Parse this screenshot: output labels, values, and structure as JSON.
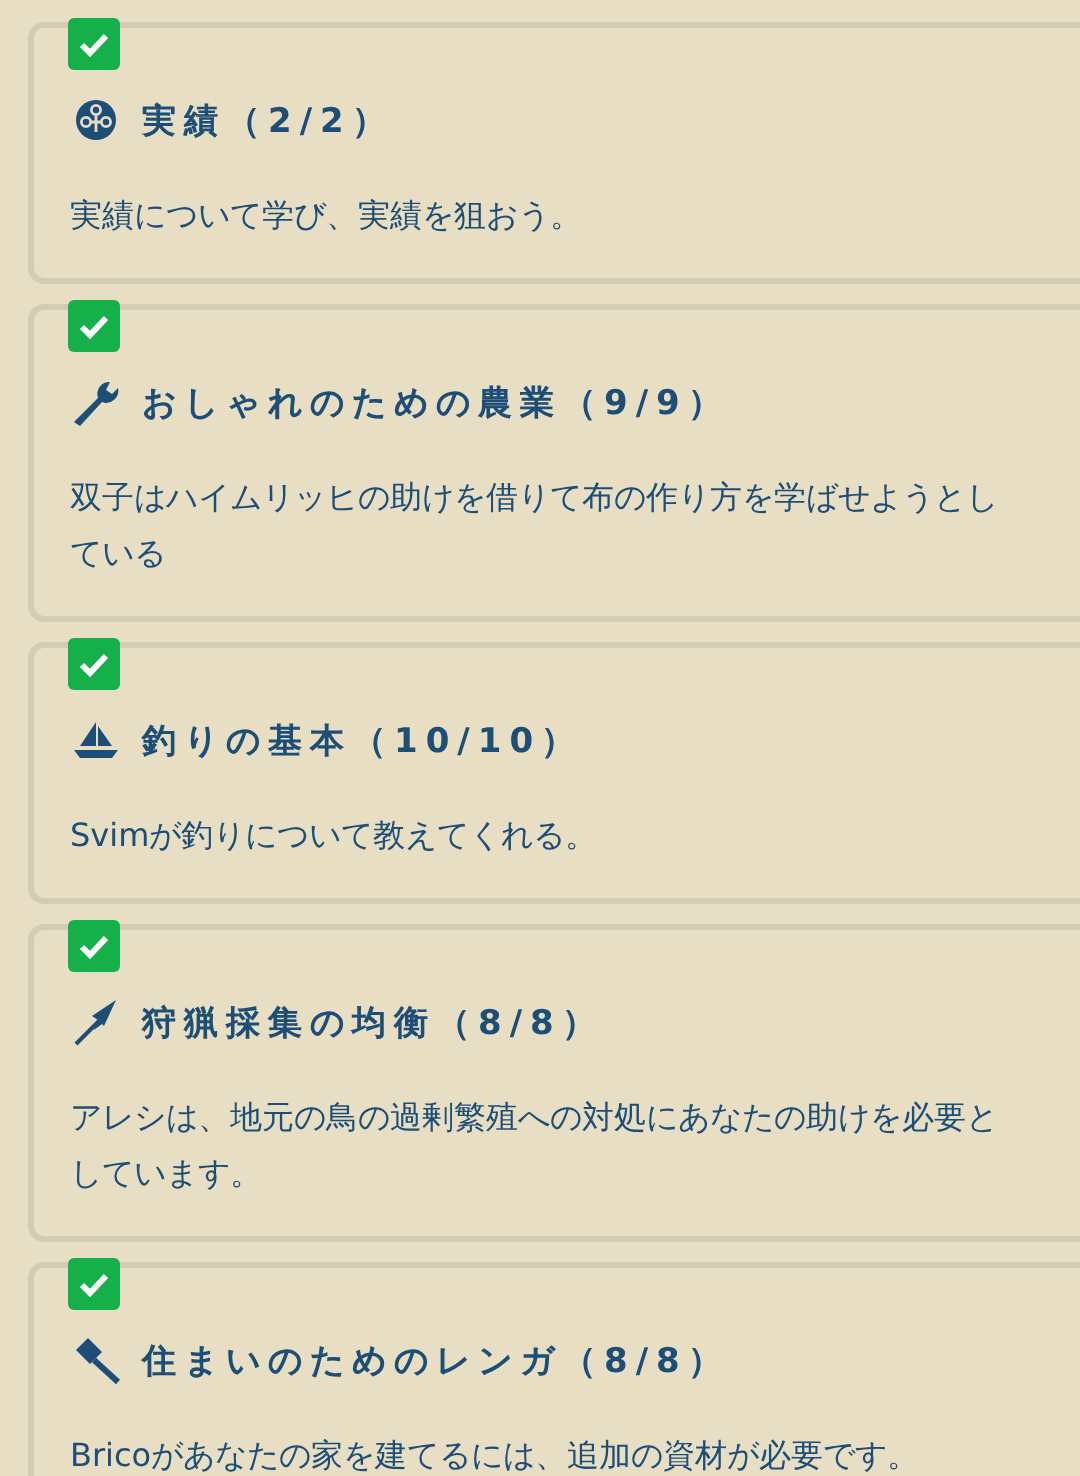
{
  "quests": [
    {
      "kind": "medal",
      "completed": true,
      "title": "実績（2/2）",
      "description": "実績について学び、実績を狙おう。"
    },
    {
      "kind": "wrench",
      "completed": true,
      "title": "おしゃれのための農業（9/9）",
      "description": "双子はハイムリッヒの助けを借りて布の作り方を学ばせようとしている"
    },
    {
      "kind": "boat",
      "completed": true,
      "title": "釣りの基本（10/10）",
      "description": "Svimが釣りについて教えてくれる。"
    },
    {
      "kind": "arrow",
      "completed": true,
      "title": "狩猟採集の均衡（8/8）",
      "description": "アレシは、地元の鳥の過剰繁殖への対処にあなたの助けを必要としています。"
    },
    {
      "kind": "hammer",
      "completed": true,
      "title": "住まいのためのレンガ（8/8）",
      "description": "Bricoがあなたの家を建てるには、追加の資材が必要です。"
    }
  ]
}
